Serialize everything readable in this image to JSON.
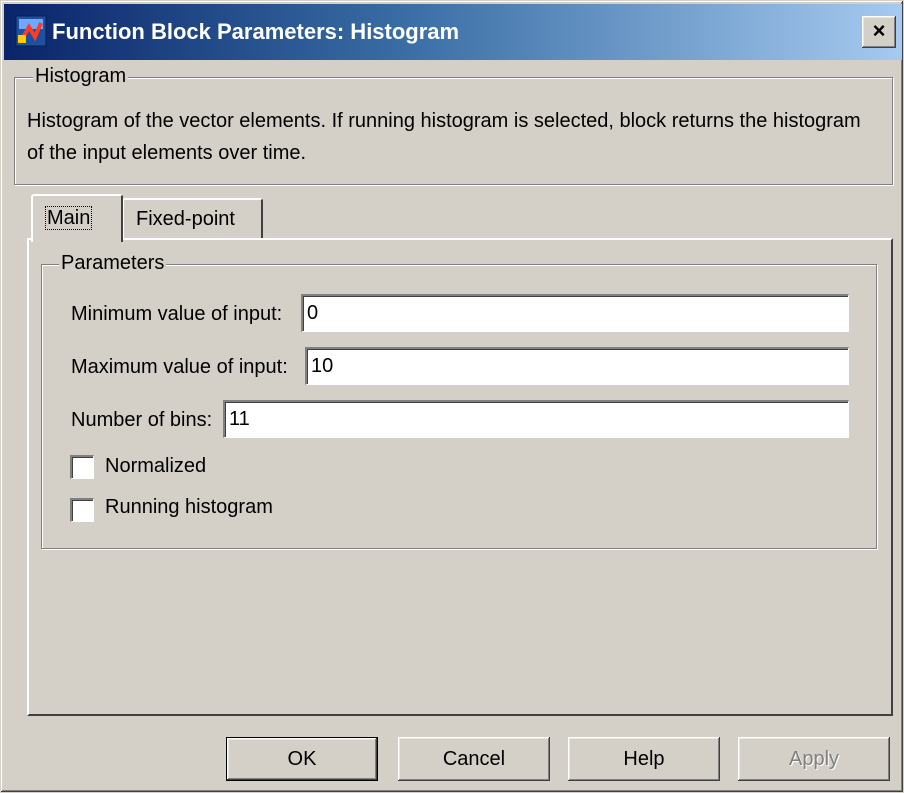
{
  "window": {
    "title": "Function Block Parameters: Histogram",
    "close_label": "×"
  },
  "description_group": {
    "legend": "Histogram",
    "text": "Histogram of the vector elements.  If running histogram is selected, block returns the histogram of the input elements over time."
  },
  "tabs": [
    {
      "label": "Main",
      "selected": true
    },
    {
      "label": "Fixed-point",
      "selected": false
    }
  ],
  "parameters": {
    "legend": "Parameters",
    "min_label": "Minimum value of input:",
    "min_value": "0",
    "max_label": "Maximum value of input:",
    "max_value": "10",
    "bins_label": "Number of bins:",
    "bins_value": "11",
    "normalized_label": "Normalized",
    "normalized_checked": false,
    "running_label": "Running histogram",
    "running_checked": false
  },
  "buttons": {
    "ok": "OK",
    "cancel": "Cancel",
    "help": "Help",
    "apply": "Apply"
  },
  "colors": {
    "title_start": "#0a246a",
    "title_end": "#a6caf0",
    "face": "#d4d0c8"
  },
  "icons": {
    "app": "simulink-block-icon",
    "close": "close-icon"
  }
}
